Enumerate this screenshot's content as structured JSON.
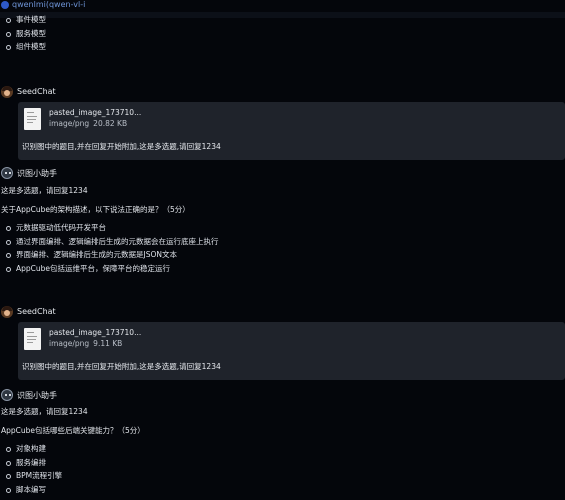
{
  "header": {
    "model_title": "qwenlmi(qwen-vl-i"
  },
  "intro_list": [
    "事件模型",
    "服务模型",
    "组件模型"
  ],
  "conversation": [
    {
      "user": "SeedChat",
      "attachment": {
        "file_name": "pasted_image_173710...",
        "file_type": "image/png",
        "file_size": "20.82 KB"
      },
      "message": "识别图中的题目,并在回复开始附加,这是多选题,请回复1234"
    },
    {
      "assistant": "识图小助手",
      "lead": "这是多选题，请回复1234",
      "question": "关于AppCube的架构描述，以下说法正确的是？（5分）",
      "options": [
        "元数据驱动低代码开发平台",
        "通过界面编排、逻辑编排后生成的元数据会在运行底座上执行",
        "界面编排、逻辑编排后生成的元数据是JSON文本",
        "AppCube包括运维平台，保障平台的稳定运行"
      ]
    },
    {
      "user": "SeedChat",
      "attachment": {
        "file_name": "pasted_image_173710...",
        "file_type": "image/png",
        "file_size": "9.11 KB"
      },
      "message": "识别图中的题目,并在回复开始附加,这是多选题,请回复1234"
    },
    {
      "assistant": "识图小助手",
      "lead": "这是多选题，请回复1234",
      "question": "AppCube包括哪些后端关键能力？（5分）",
      "options": [
        "对象构建",
        "服务编排",
        "BPM流程引擎",
        "脚本编写"
      ]
    }
  ],
  "colors": {
    "background": "#04060b",
    "bubble": "#1f232b",
    "title_link": "#6f95d8"
  },
  "icons": [
    "model-dot-icon",
    "user-avatar-icon",
    "bot-avatar-icon",
    "file-thumbnail-icon"
  ]
}
